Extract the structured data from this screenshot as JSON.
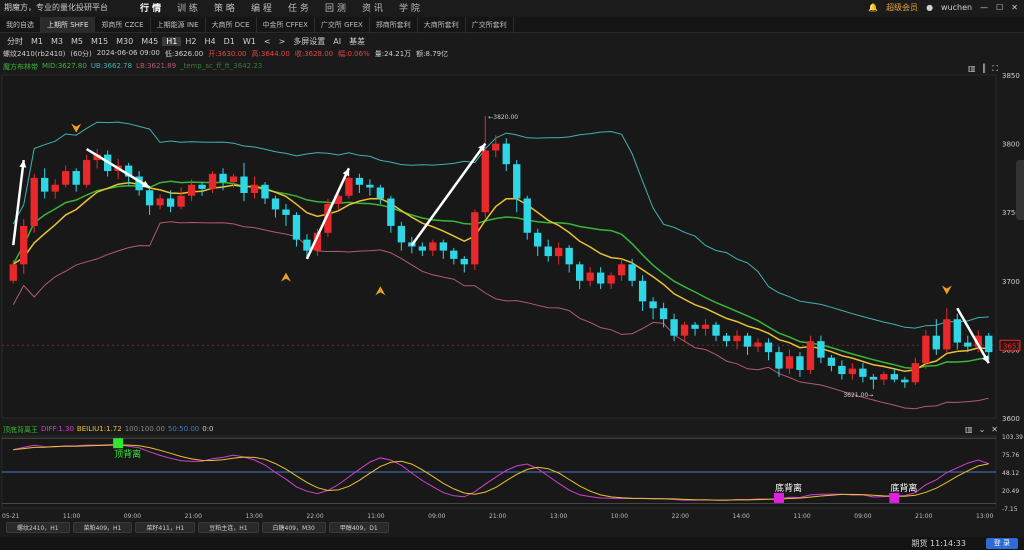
{
  "app": {
    "title": "期魔方，专业的量化投研平台"
  },
  "main_nav": [
    "行 情",
    "训 练",
    "策 略",
    "编 程",
    "任 务",
    "回 测",
    "资 讯",
    "学 院"
  ],
  "main_nav_active": 0,
  "window": {
    "vip_label": "超级会员",
    "user": "wuchen"
  },
  "exchange_tabs": [
    "我的自选",
    "上期所 SHFE",
    "郑商所 CZCE",
    "上期能源 INE",
    "大商所 DCE",
    "中金所 CFFEX",
    "广交所 GFEX",
    "郑商所套利",
    "大商所套利",
    "广交所套利"
  ],
  "exchange_active": 1,
  "periods": [
    "分时",
    "M1",
    "M3",
    "M5",
    "M15",
    "M30",
    "M45",
    "H1",
    "H2",
    "H4",
    "D1",
    "W1",
    "<",
    ">",
    "多屏设置",
    "AI",
    "基差"
  ],
  "period_active": 7,
  "info": {
    "contract": "螺纹2410(rb2410)",
    "period": "(60分)",
    "datetime": "2024-06-06  09:00",
    "low": "低:3626.00",
    "open": "开:3630.00",
    "high": "高:3644.00",
    "close": "收:3628.00",
    "change": "幅:0.06%",
    "volume": "量:24.21万",
    "amount": "额:8.79亿"
  },
  "indicator": {
    "name": "魔方布林带",
    "mid": "MID:3627.80",
    "ub": "UB:3662.78",
    "lb": "LB:3621.89",
    "temp": "_temp_sc_ff_ft_3642.23"
  },
  "sub_indicator": {
    "name": "顶底背离王",
    "diff": "DIFF:1.30",
    "beiliu": "BEILIU1:1.72",
    "v100": "100:100.00",
    "v50": "50:50.00",
    "v0": "0:0"
  },
  "price_axis": [
    "3850",
    "3800",
    "3750",
    "3700",
    "3650",
    "3600"
  ],
  "last_price": "3653",
  "sub_axis": [
    "103.39",
    "75.76",
    "48.12",
    "20.49",
    "-7.15"
  ],
  "time_axis": [
    "05-21",
    "11:00",
    "09:00",
    "21:00",
    "13:00",
    "22:00",
    "11:00",
    "09:00",
    "21:00",
    "13:00",
    "10:00",
    "22:00",
    "14:00",
    "11:00",
    "09:00",
    "21:00",
    "13:00"
  ],
  "annotations": {
    "peak": "3820.00",
    "trough": "3621.00"
  },
  "signals": {
    "top": "顶背离",
    "bottom1": "底背离",
    "bottom2": "底背离"
  },
  "bottom_tabs": [
    "螺纹2410，H1",
    "菜粕409，H1",
    "菜籽411，H1",
    "豆粕主连，H1",
    "白糖409，M30",
    "甲醇409，D1"
  ],
  "status": {
    "time": "期货 11:14:33",
    "login": "登 录"
  },
  "colors": {
    "up": "#e8292b",
    "down": "#2fd6e6",
    "mid": "#3ab53a",
    "ub": "#3fb3b3",
    "lb": "#b35a6e",
    "ema": "#e9c233",
    "arrow": "#ffffff",
    "signal_marker": "#f0a020"
  },
  "chart_data": {
    "type": "candlestick",
    "symbol": "螺纹2410",
    "timeframe": "H1",
    "ylim": [
      3600,
      3850
    ],
    "candles": [
      [
        3700,
        3712,
        3698,
        3715
      ],
      [
        3712,
        3740,
        3705,
        3745
      ],
      [
        3740,
        3775,
        3735,
        3778
      ],
      [
        3775,
        3765,
        3760,
        3782
      ],
      [
        3765,
        3770,
        3760,
        3774
      ],
      [
        3770,
        3780,
        3768,
        3784
      ],
      [
        3780,
        3770,
        3765,
        3782
      ],
      [
        3770,
        3788,
        3768,
        3792
      ],
      [
        3788,
        3792,
        3782,
        3796
      ],
      [
        3792,
        3780,
        3776,
        3795
      ],
      [
        3780,
        3784,
        3774,
        3789
      ],
      [
        3784,
        3776,
        3770,
        3786
      ],
      [
        3776,
        3766,
        3762,
        3780
      ],
      [
        3766,
        3755,
        3748,
        3768
      ],
      [
        3755,
        3760,
        3752,
        3763
      ],
      [
        3760,
        3754,
        3750,
        3766
      ],
      [
        3754,
        3762,
        3752,
        3768
      ],
      [
        3762,
        3770,
        3758,
        3774
      ],
      [
        3770,
        3767,
        3762,
        3772
      ],
      [
        3767,
        3778,
        3764,
        3780
      ],
      [
        3778,
        3772,
        3766,
        3782
      ],
      [
        3772,
        3776,
        3768,
        3778
      ],
      [
        3776,
        3764,
        3758,
        3786
      ],
      [
        3764,
        3770,
        3760,
        3776
      ],
      [
        3770,
        3760,
        3756,
        3772
      ],
      [
        3760,
        3752,
        3746,
        3762
      ],
      [
        3752,
        3748,
        3740,
        3756
      ],
      [
        3748,
        3730,
        3725,
        3750
      ],
      [
        3730,
        3722,
        3716,
        3734
      ],
      [
        3722,
        3735,
        3718,
        3738
      ],
      [
        3735,
        3756,
        3732,
        3760
      ],
      [
        3756,
        3762,
        3752,
        3766
      ],
      [
        3762,
        3775,
        3760,
        3780
      ],
      [
        3775,
        3770,
        3764,
        3778
      ],
      [
        3770,
        3768,
        3762,
        3774
      ],
      [
        3768,
        3760,
        3756,
        3770
      ],
      [
        3760,
        3740,
        3735,
        3762
      ],
      [
        3740,
        3728,
        3722,
        3743
      ],
      [
        3728,
        3725,
        3720,
        3732
      ],
      [
        3725,
        3722,
        3718,
        3728
      ],
      [
        3722,
        3728,
        3718,
        3730
      ],
      [
        3728,
        3722,
        3716,
        3730
      ],
      [
        3722,
        3716,
        3712,
        3724
      ],
      [
        3716,
        3712,
        3706,
        3718
      ],
      [
        3712,
        3750,
        3708,
        3752
      ],
      [
        3750,
        3795,
        3746,
        3820
      ],
      [
        3795,
        3800,
        3790,
        3806
      ],
      [
        3800,
        3785,
        3780,
        3804
      ],
      [
        3785,
        3760,
        3750,
        3788
      ],
      [
        3760,
        3735,
        3730,
        3762
      ],
      [
        3735,
        3725,
        3718,
        3738
      ],
      [
        3725,
        3718,
        3714,
        3730
      ],
      [
        3718,
        3724,
        3712,
        3728
      ],
      [
        3724,
        3712,
        3706,
        3726
      ],
      [
        3712,
        3700,
        3694,
        3714
      ],
      [
        3700,
        3706,
        3696,
        3710
      ],
      [
        3706,
        3698,
        3694,
        3710
      ],
      [
        3698,
        3704,
        3694,
        3706
      ],
      [
        3704,
        3712,
        3700,
        3716
      ],
      [
        3712,
        3700,
        3696,
        3716
      ],
      [
        3700,
        3685,
        3678,
        3704
      ],
      [
        3685,
        3680,
        3672,
        3688
      ],
      [
        3680,
        3672,
        3666,
        3684
      ],
      [
        3672,
        3660,
        3656,
        3676
      ],
      [
        3660,
        3668,
        3656,
        3670
      ],
      [
        3668,
        3665,
        3660,
        3670
      ],
      [
        3665,
        3668,
        3660,
        3672
      ],
      [
        3668,
        3660,
        3656,
        3670
      ],
      [
        3660,
        3656,
        3652,
        3662
      ],
      [
        3656,
        3660,
        3650,
        3664
      ],
      [
        3660,
        3652,
        3646,
        3662
      ],
      [
        3652,
        3655,
        3648,
        3658
      ],
      [
        3655,
        3648,
        3642,
        3658
      ],
      [
        3648,
        3636,
        3630,
        3652
      ],
      [
        3636,
        3645,
        3632,
        3650
      ],
      [
        3645,
        3635,
        3630,
        3648
      ],
      [
        3635,
        3656,
        3632,
        3660
      ],
      [
        3656,
        3644,
        3640,
        3660
      ],
      [
        3644,
        3638,
        3634,
        3646
      ],
      [
        3638,
        3632,
        3628,
        3642
      ],
      [
        3632,
        3636,
        3628,
        3640
      ],
      [
        3636,
        3630,
        3626,
        3640
      ],
      [
        3630,
        3628,
        3621,
        3632
      ],
      [
        3628,
        3632,
        3624,
        3634
      ],
      [
        3632,
        3628,
        3626,
        3636
      ],
      [
        3628,
        3626,
        3622,
        3630
      ],
      [
        3626,
        3640,
        3624,
        3644
      ],
      [
        3640,
        3660,
        3636,
        3664
      ],
      [
        3660,
        3650,
        3646,
        3672
      ],
      [
        3650,
        3672,
        3648,
        3680
      ],
      [
        3672,
        3655,
        3650,
        3676
      ],
      [
        3655,
        3652,
        3648,
        3660
      ],
      [
        3652,
        3660,
        3648,
        3664
      ],
      [
        3660,
        3648,
        3642,
        3662
      ]
    ],
    "candle_fields": [
      "open",
      "close",
      "low",
      "high"
    ],
    "sub_ylim": [
      -7.15,
      103.39
    ]
  }
}
